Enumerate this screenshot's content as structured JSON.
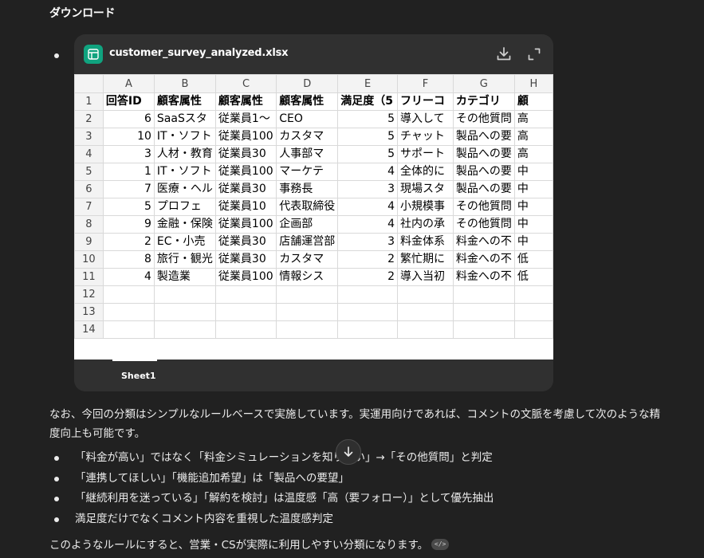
{
  "heading": "ダウンロード",
  "file": {
    "name": "customer_survey_analyzed.xlsx",
    "icon": "spreadsheet-icon",
    "actions": [
      "download-icon",
      "expand-icon"
    ],
    "accent": "#10a37f"
  },
  "sheet": {
    "columns": [
      "A",
      "B",
      "C",
      "D",
      "E",
      "F",
      "G",
      "H"
    ],
    "rows": [
      {
        "n": "1",
        "cells": [
          "回答ID",
          "顧客属性",
          "顧客属性",
          "顧客属性",
          "満足度（5",
          "フリーコ",
          "カテゴリ",
          "顧"
        ]
      },
      {
        "n": "2",
        "cells": [
          "6",
          "SaaSスタ",
          "従業員1〜",
          "CEO",
          "5",
          "導入して",
          "その他質問",
          "高"
        ]
      },
      {
        "n": "3",
        "cells": [
          "10",
          "IT・ソフト",
          "従業員100",
          "カスタマ",
          "5",
          "チャット",
          "製品への要",
          "高"
        ]
      },
      {
        "n": "4",
        "cells": [
          "3",
          "人材・教育",
          "従業員30",
          "人事部マ",
          "5",
          "サポート",
          "製品への要",
          "高"
        ]
      },
      {
        "n": "5",
        "cells": [
          "1",
          "IT・ソフト",
          "従業員100",
          "マーケテ",
          "4",
          "全体的に",
          "製品への要",
          "中"
        ]
      },
      {
        "n": "6",
        "cells": [
          "7",
          "医療・ヘル",
          "従業員30",
          "事務長",
          "3",
          "現場スタ",
          "製品への要",
          "中"
        ]
      },
      {
        "n": "7",
        "cells": [
          "5",
          "プロフェ",
          "従業員10",
          "代表取締役",
          "4",
          "小規模事",
          "その他質問",
          "中"
        ]
      },
      {
        "n": "8",
        "cells": [
          "9",
          "金融・保険",
          "従業員100",
          "企画部",
          "4",
          "社内の承",
          "その他質問",
          "中"
        ]
      },
      {
        "n": "9",
        "cells": [
          "2",
          "EC・小売",
          "従業員30",
          "店舗運営部",
          "3",
          "料金体系",
          "料金への不",
          "中"
        ]
      },
      {
        "n": "10",
        "cells": [
          "8",
          "旅行・観光",
          "従業員30",
          "カスタマ",
          "2",
          "繁忙期に",
          "料金への不",
          "低"
        ]
      },
      {
        "n": "11",
        "cells": [
          "4",
          "製造業",
          "従業員100",
          "情報シス",
          "2",
          "導入当初",
          "料金への不",
          "低"
        ]
      },
      {
        "n": "12",
        "cells": [
          "",
          "",
          "",
          "",
          "",
          "",
          "",
          ""
        ]
      },
      {
        "n": "13",
        "cells": [
          "",
          "",
          "",
          "",
          "",
          "",
          "",
          ""
        ]
      },
      {
        "n": "14",
        "cells": [
          "",
          "",
          "",
          "",
          "",
          "",
          "",
          ""
        ]
      }
    ],
    "tab": "Sheet1"
  },
  "paragraph1_line1": "なお、今回の分類はシンプルなルールベースで実施しています。実運用向けであれば、コメントの文脈を考慮して次のような精",
  "paragraph1_line2": "度向上も可能です。",
  "bullets": [
    "「料金が高い」ではなく「料金シミュレーションを知りたい」→「その他質問」と判定",
    "「連携してほしい」「機能追加希望」は「製品への要望」",
    "「継続利用を迷っている」「解約を検討」は温度感「高（要フォロー）」として優先抽出",
    "満足度だけでなくコメント内容を重視した温度感判定"
  ],
  "closing": "このようなルールにすると、営業・CSが実際に利用しやすい分類になります。",
  "code_badge": "</>"
}
